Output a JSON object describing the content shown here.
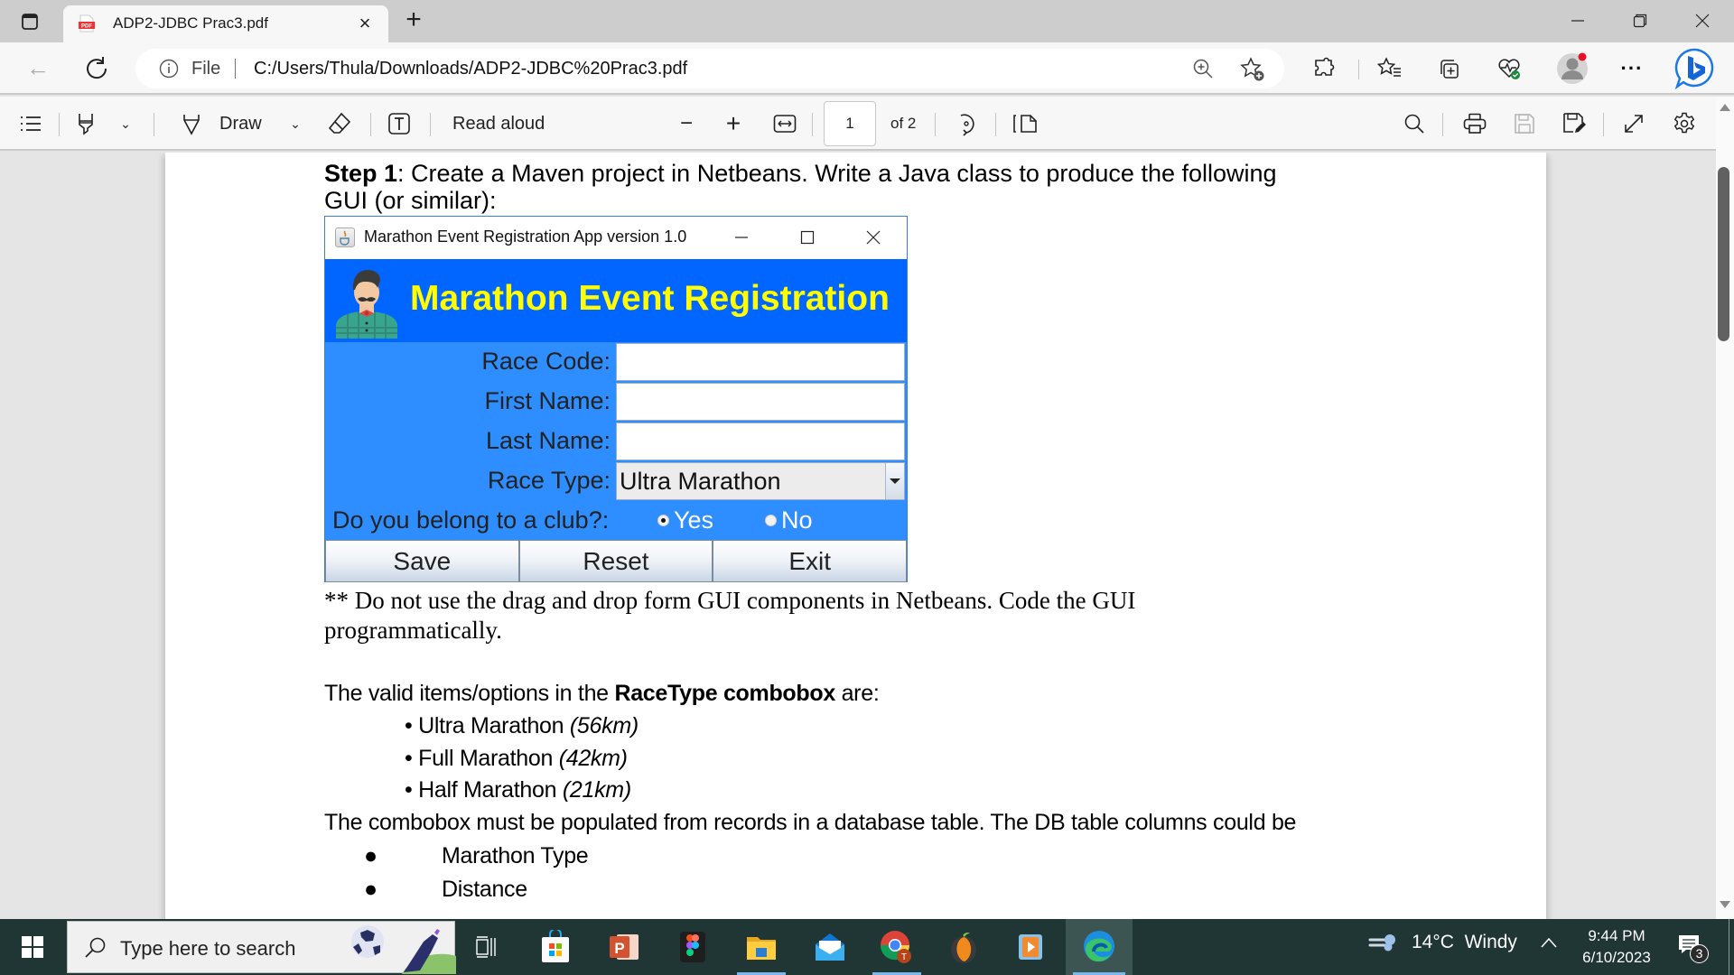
{
  "browser": {
    "tab": {
      "title": "ADP2-JDBC Prac3.pdf",
      "icon": "pdf-icon"
    },
    "address": {
      "scheme_label": "File",
      "url": "C:/Users/Thula/Downloads/ADP2-JDBC%20Prac3.pdf"
    },
    "toolbar_icons": [
      "zoom-icon",
      "add-favorite-icon",
      "extensions-icon",
      "favorites-icon",
      "collections-icon",
      "browser-essentials-icon",
      "profile-avatar",
      "more-icon",
      "bing-chat-icon"
    ]
  },
  "pdf_toolbar": {
    "draw_label": "Draw",
    "read_aloud_label": "Read aloud",
    "page_current": "1",
    "page_total_label": "of 2"
  },
  "document": {
    "step_bold": "Step 1",
    "step_text": ": Create a Maven project in Netbeans. Write a Java class to produce the following",
    "step_text2": "GUI (or similar):",
    "note_line1": "** Do not use the drag and drop form GUI components in Netbeans. Code the GUI",
    "note_line2": "programmatically.",
    "valid_intro_pre": "The valid items/options in the ",
    "valid_intro_bold": "RaceType combobox",
    "valid_intro_post": " are:",
    "race_options": [
      {
        "name": "Ultra Marathon ",
        "distance": "(56km)"
      },
      {
        "name": "Full Marathon ",
        "distance": "(42km)"
      },
      {
        "name": "Half Marathon ",
        "distance": "(21km)"
      }
    ],
    "db_sentence": "The combobox must be populated from records in a database table. The DB table columns could be",
    "db_columns": [
      "Marathon Type",
      "Distance"
    ]
  },
  "java_app": {
    "window_title": "Marathon Event Registration App version 1.0",
    "banner_title": "Marathon Event Registration",
    "fields": [
      {
        "label": "Race Code:",
        "value": ""
      },
      {
        "label": "First Name:",
        "value": ""
      },
      {
        "label": "Last Name:",
        "value": ""
      }
    ],
    "race_type_label": "Race Type:",
    "race_type_value": "Ultra Marathon",
    "club_label": "Do you belong to a club?:",
    "club_yes": "Yes",
    "club_no": "No",
    "club_selected": "Yes",
    "buttons": {
      "save": "Save",
      "reset": "Reset",
      "exit": "Exit"
    },
    "colors": {
      "banner": "#0066ff",
      "form": "#2e8eff",
      "heading": "#ffff00"
    }
  },
  "taskbar": {
    "search_placeholder": "Type here to search",
    "apps": [
      "task-view",
      "microsoft-store",
      "powerpoint",
      "figma",
      "file-explorer",
      "mail",
      "chrome",
      "fl-studio",
      "media-player",
      "edge"
    ],
    "weather": "14°C  Windy",
    "time": "9:44 PM",
    "date": "6/10/2023",
    "notification_count": "3"
  }
}
